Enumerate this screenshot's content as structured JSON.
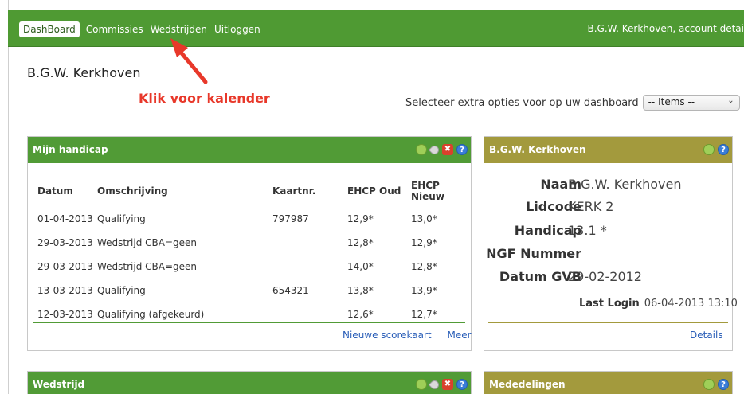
{
  "nav": {
    "items": [
      "DashBoard",
      "Commissies",
      "Wedstrijden",
      "Uitloggen"
    ],
    "account": "B.G.W. Kerkhoven, account detai"
  },
  "annotation": {
    "callout": "Klik voor kalender",
    "color": "#e8382a"
  },
  "user_title": "B.G.W. Kerkhoven",
  "options": {
    "label": "Selecteer extra opties voor op uw dashboard",
    "select_value": "-- Items --",
    "caret": "⌄"
  },
  "handicap_panel": {
    "title": "Mijn handicap",
    "columns": [
      "Datum",
      "Omschrijving",
      "Kaartnr.",
      "EHCP Oud",
      "EHCP Nieuw"
    ],
    "rows": [
      [
        "01-04-2013",
        "Qualifying",
        "797987",
        "12,9*",
        "13,0*"
      ],
      [
        "29-03-2013",
        "Wedstrijd CBA=geen",
        "",
        "12,8*",
        "12,9*"
      ],
      [
        "29-03-2013",
        "Wedstrijd CBA=geen",
        "",
        "14,0*",
        "12,8*"
      ],
      [
        "13-03-2013",
        "Qualifying",
        "654321",
        "13,8*",
        "13,9*"
      ],
      [
        "12-03-2013",
        "Qualifying (afgekeurd)",
        "",
        "12,6*",
        "12,7*"
      ]
    ],
    "links": [
      "Nieuwe scorekaart",
      "Meer"
    ]
  },
  "profile_panel": {
    "title": "B.G.W. Kerkhoven",
    "fields": [
      {
        "label": "Naam",
        "value": "B.G.W. Kerkhoven"
      },
      {
        "label": "Lidcode",
        "value": "KERK 2"
      },
      {
        "label": "Handicap",
        "value": "13.1 *"
      },
      {
        "label": "NGF Nummer",
        "value": ""
      },
      {
        "label": "Datum GVB",
        "value": "29-02-2012"
      }
    ],
    "last_login_label": "Last Login",
    "last_login_value": "06-04-2013 13:10",
    "details_link": "Details"
  },
  "wedstrijd_panel": {
    "title": "Wedstrijd"
  },
  "mededelingen_panel": {
    "title": "Mededelingen"
  },
  "icons": {
    "close": "✖",
    "help": "?"
  },
  "colors": {
    "nav_green": "#4f9a33",
    "panel_green": "#519b36",
    "panel_olive": "#a39a3d",
    "link_blue": "#2b5fb8"
  }
}
